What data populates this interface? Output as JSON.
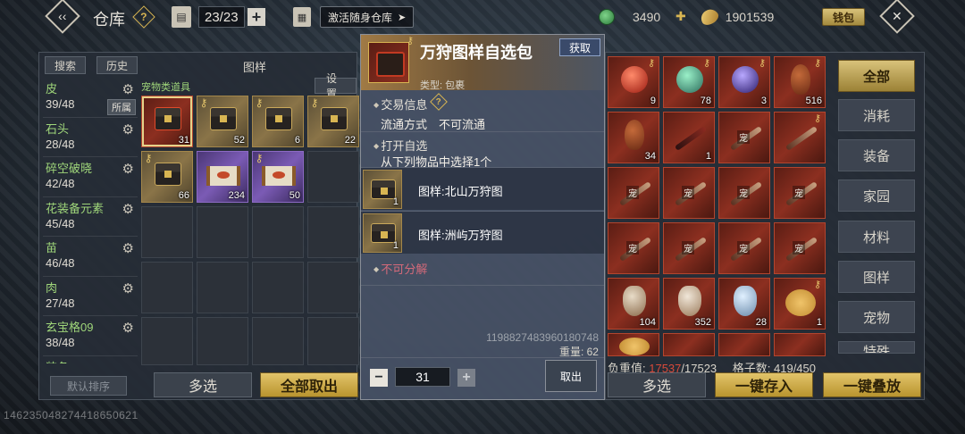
{
  "topbar": {
    "title": "仓库",
    "help_icon": "question-icon",
    "capacity": "23/23",
    "activate_label": "激活随身仓库",
    "currency_green": "3490",
    "currency_gold": "1901539",
    "wallet_label": "钱包"
  },
  "left": {
    "search_tab": "搜索",
    "history_tab": "历史",
    "panel_title": "图样",
    "subcategory": "宠物类道具",
    "settings_label": "设置",
    "categories": [
      {
        "name": "皮",
        "count": "39/48",
        "tag": "所属"
      },
      {
        "name": "石头",
        "count": "28/48"
      },
      {
        "name": "碎空破晓",
        "count": "42/48"
      },
      {
        "name": "花装备元素",
        "count": "45/48"
      },
      {
        "name": "苗",
        "count": "46/48"
      },
      {
        "name": "肉",
        "count": "27/48"
      },
      {
        "name": "玄宝格09",
        "count": "38/48"
      },
      {
        "name": "装备",
        "count": ""
      }
    ],
    "items": [
      {
        "count": "31",
        "kind": "red-chest"
      },
      {
        "count": "52",
        "kind": "chest"
      },
      {
        "count": "6",
        "kind": "chest"
      },
      {
        "count": "22",
        "kind": "chest"
      },
      {
        "count": "66",
        "kind": "chest"
      },
      {
        "count": "234",
        "kind": "purple-scroll"
      },
      {
        "count": "50",
        "kind": "purple-scroll"
      }
    ],
    "default_sort": "默认排序",
    "multi_select": "多选",
    "take_all": "全部取出"
  },
  "detail": {
    "title": "万狩图样自选包",
    "get_label": "获取",
    "type_label": "类型: 包裹",
    "trade_info": "交易信息",
    "circulation": "流通方式　不可流通",
    "open_choose": "打开自选",
    "choose_hint": "从下列物品中选择1个",
    "options": [
      {
        "name": "图样:北山万狩图",
        "count": "1"
      },
      {
        "name": "图样:洲屿万狩图",
        "count": "1"
      }
    ],
    "no_split": "不可分解",
    "item_id": "1198827483960180748",
    "weight": "重量: 62",
    "quantity": "31",
    "take_out": "取出"
  },
  "right": {
    "filters": [
      "全部",
      "消耗",
      "装备",
      "家园",
      "材料",
      "图样",
      "宠物",
      "特殊"
    ],
    "items": [
      {
        "kind": "red-orb",
        "count": "9"
      },
      {
        "kind": "jade",
        "count": "78"
      },
      {
        "kind": "blue-orb",
        "count": "3"
      },
      {
        "kind": "gourd",
        "count": "516"
      },
      {
        "kind": "gourd",
        "count": "34"
      },
      {
        "kind": "claw",
        "count": "1"
      },
      {
        "kind": "blade",
        "count": "",
        "pet": "宠"
      },
      {
        "kind": "blade",
        "count": ""
      },
      {
        "kind": "blade",
        "count": "",
        "pet": "宠"
      },
      {
        "kind": "blade",
        "count": "",
        "pet": "宠"
      },
      {
        "kind": "blade",
        "count": "",
        "pet": "宠"
      },
      {
        "kind": "blade",
        "count": "",
        "pet": "宠"
      },
      {
        "kind": "blade",
        "count": "",
        "pet": "宠"
      },
      {
        "kind": "blade",
        "count": "",
        "pet": "宠"
      },
      {
        "kind": "blade",
        "count": "",
        "pet": "宠"
      },
      {
        "kind": "blade",
        "count": "",
        "pet": "宠"
      },
      {
        "kind": "vase-red",
        "count": "104"
      },
      {
        "kind": "vase-red",
        "count": "352"
      },
      {
        "kind": "vase-blue",
        "count": "28"
      },
      {
        "kind": "cake",
        "count": "1"
      }
    ],
    "weight_label": "负重值: ",
    "weight_current": "17537",
    "weight_max": "/17523",
    "slots_label": "格子数: 419/450",
    "multi_select": "多选",
    "store_all": "一键存入",
    "stack_all": "一键叠放"
  },
  "watermark": "146235048274418650621"
}
